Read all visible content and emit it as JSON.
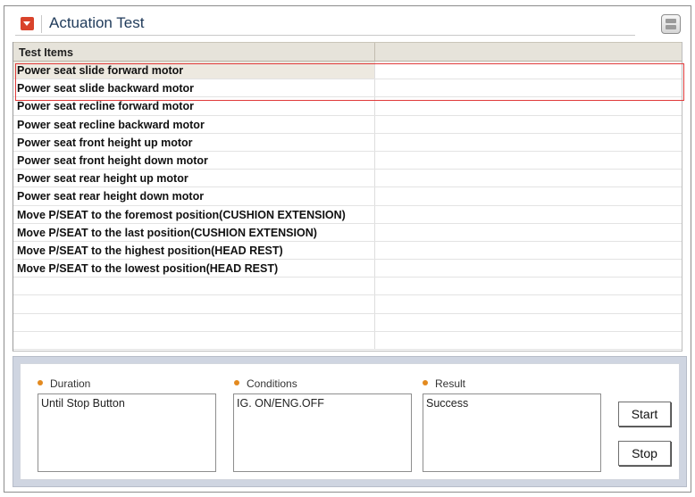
{
  "window": {
    "title": "Actuation Test"
  },
  "grid": {
    "header": {
      "col1": "Test Items",
      "col2": ""
    },
    "rows": [
      "Power seat slide forward motor",
      "Power seat slide backward motor",
      "Power seat recline forward motor",
      "Power seat recline backward motor",
      "Power seat front height up motor",
      "Power seat front height down motor",
      "Power seat rear height up motor",
      "Power seat rear height down motor",
      "Move P/SEAT to the foremost position(CUSHION EXTENSION)",
      "Move P/SEAT to the last position(CUSHION EXTENSION)",
      "Move P/SEAT to the highest position(HEAD REST)",
      "Move P/SEAT to the lowest position(HEAD REST)",
      "",
      "",
      "",
      ""
    ],
    "selected_row": 0,
    "highlighted_rows": [
      0,
      1
    ]
  },
  "details": {
    "duration_label": "Duration",
    "duration_value": "Until Stop Button",
    "conditions_label": "Conditions",
    "conditions_value": "IG. ON/ENG.OFF",
    "result_label": "Result",
    "result_value": "Success"
  },
  "buttons": {
    "start": "Start",
    "stop": "Stop"
  },
  "colors": {
    "accent": "#d9432b",
    "highlight_border": "#e03a3a",
    "label_dot": "#e38a1f",
    "panel_bg": "#cfd5e1"
  }
}
